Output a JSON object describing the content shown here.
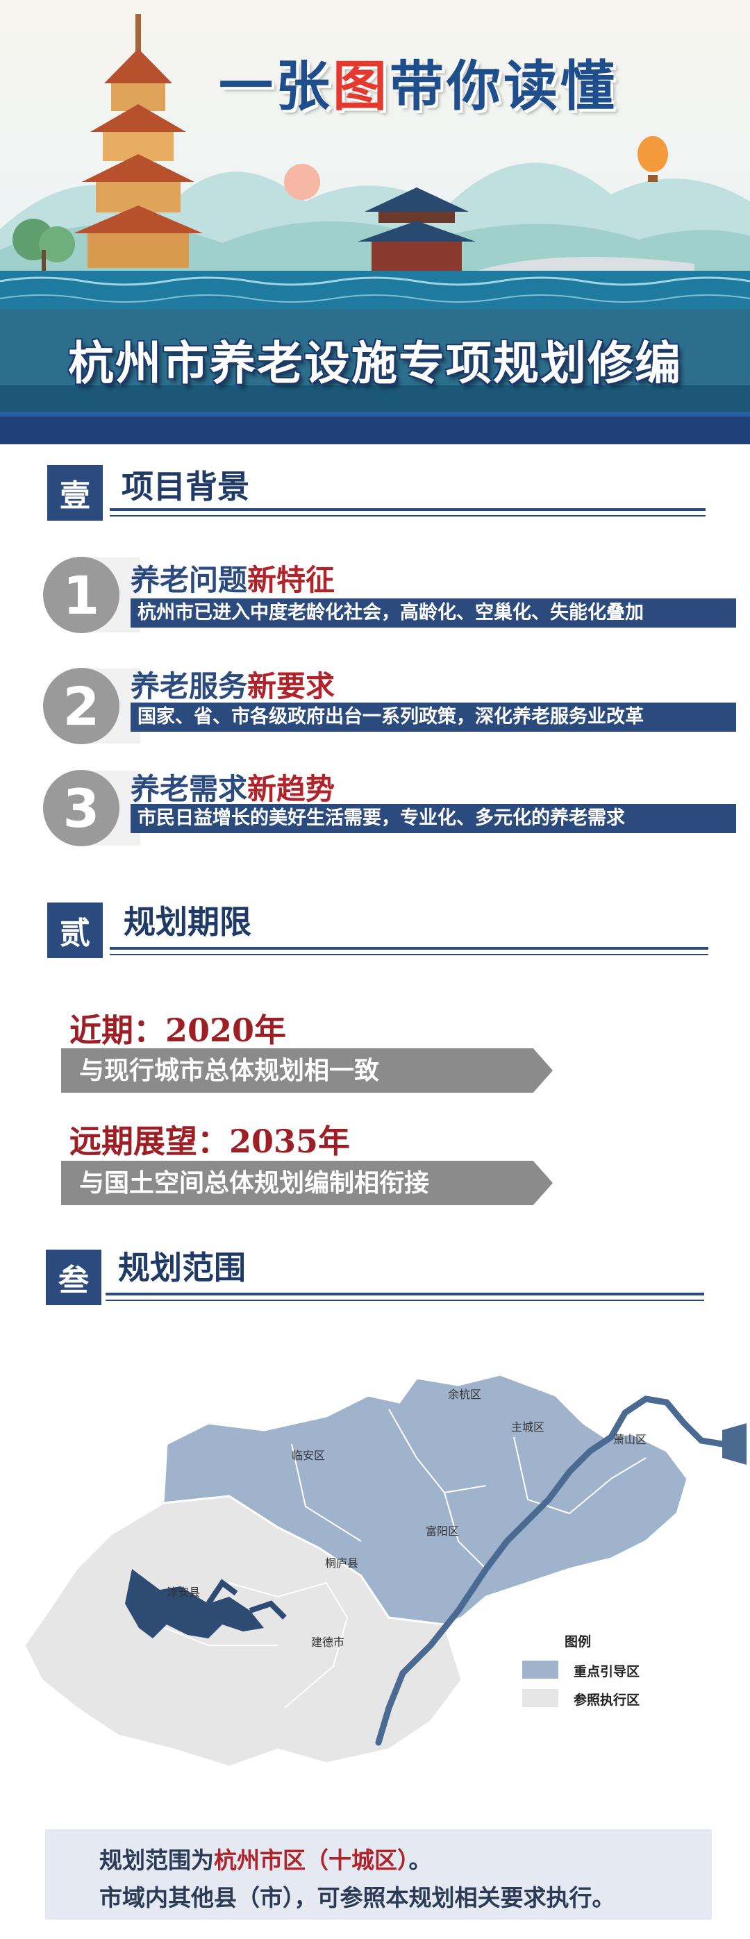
{
  "colors": {
    "primary": "#2b4a7e",
    "accent_red": "#b1232b",
    "banner_red": "#e5382e",
    "gray_bar": "#8b8b8b",
    "key_zone": "#9fb3cd",
    "ref_zone": "#e6e6e6"
  },
  "banner": {
    "title_top_prefix": "一张",
    "title_top_highlight": "图",
    "title_top_suffix": "带你读懂",
    "title_main": "杭州市养老设施专项规划修编"
  },
  "section1": {
    "badge": "壹",
    "title": "项目背景",
    "items": [
      {
        "num": "1",
        "head": "养老问题",
        "head_red": "新特征",
        "desc": "杭州市已进入中度老龄化社会，高龄化、空巢化、失能化叠加"
      },
      {
        "num": "2",
        "head": "养老服务",
        "head_red": "新要求",
        "desc": "国家、省、市各级政府出台一系列政策，深化养老服务业改革"
      },
      {
        "num": "3",
        "head": "养老需求",
        "head_red": "新趋势",
        "desc": "市民日益增长的美好生活需要，专业化、多元化的养老需求"
      }
    ]
  },
  "section2": {
    "badge": "贰",
    "title": "规划期限",
    "near_label": "近期：2020年",
    "near_desc": "与现行城市总体规划相一致",
    "far_label": "远期展望：2035年",
    "far_desc": "与国土空间总体规划编制相衔接"
  },
  "section3": {
    "badge": "叁",
    "title": "规划范围",
    "map_labels": {
      "yuhang": "余杭区",
      "zhucheng": "主城区",
      "xiaoshan": "萧山区",
      "linan": "临安区",
      "fuyang": "富阳区",
      "tonglu": "桐庐县",
      "chunan": "淳安县",
      "jiande": "建德市"
    },
    "legend": {
      "title": "图例",
      "key": "重点引导区",
      "ref": "参照执行区"
    }
  },
  "footer": {
    "line1_prefix": "规划范围为",
    "line1_red": "杭州市区（十城区）",
    "line1_suffix": "。",
    "line2": "市域内其他县（市），可参照本规划相关要求执行。"
  }
}
